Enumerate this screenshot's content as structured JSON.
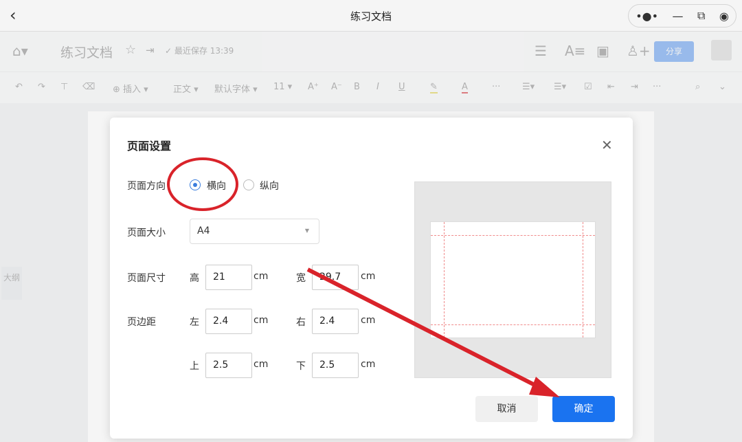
{
  "window": {
    "title": "练习文档",
    "back_icon": "chevron-left-icon",
    "controls": [
      "more-icon",
      "minimize-icon",
      "restore-icon",
      "close-target-icon"
    ]
  },
  "header": {
    "home": "home-icon",
    "doc_title": "练习文档",
    "save_status": "最近保存 13:39",
    "share": "分享"
  },
  "toolbar": {
    "insert": "插入",
    "style": "正文",
    "font": "默认字体",
    "size": "11"
  },
  "sidebar": {
    "outline": "大纲"
  },
  "dialog": {
    "title": "页面设置",
    "orientation_label": "页面方向",
    "landscape": "横向",
    "portrait": "纵向",
    "orientation_selected": "landscape",
    "size_label": "页面大小",
    "size_value": "A4",
    "dimension_label": "页面尺寸",
    "height_label": "高",
    "height_value": "21",
    "width_label": "宽",
    "width_value": "29.7",
    "margin_label": "页边距",
    "left_label": "左",
    "left_value": "2.4",
    "right_label": "右",
    "right_value": "2.4",
    "top_label": "上",
    "top_value": "2.5",
    "bottom_label": "下",
    "bottom_value": "2.5",
    "unit": "cm",
    "cancel": "取消",
    "confirm": "确定"
  },
  "annotation": {
    "color": "#d9232a"
  }
}
